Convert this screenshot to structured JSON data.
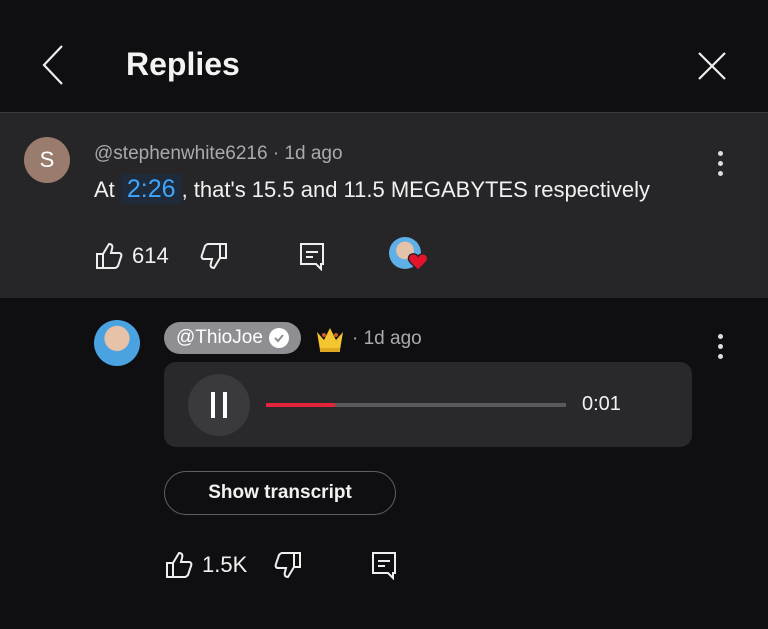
{
  "header": {
    "title": "Replies"
  },
  "parent_comment": {
    "avatar_letter": "S",
    "author": "@stephenwhite6216",
    "time": "· 1d ago",
    "text_prefix": "At ",
    "timestamp_link": "2:26",
    "text_suffix": ", that's 15.5 and 11.5 MEGABYTES respectively",
    "likes": "614"
  },
  "reply": {
    "author": "@ThioJoe",
    "time": "· 1d ago",
    "audio": {
      "elapsed": "0:01",
      "progress_percent": 23
    },
    "transcript_label": "Show transcript",
    "likes": "1.5K"
  },
  "colors": {
    "accent_link": "#3ea6ff",
    "progress": "#e3243b",
    "heart": "#e3142c"
  }
}
